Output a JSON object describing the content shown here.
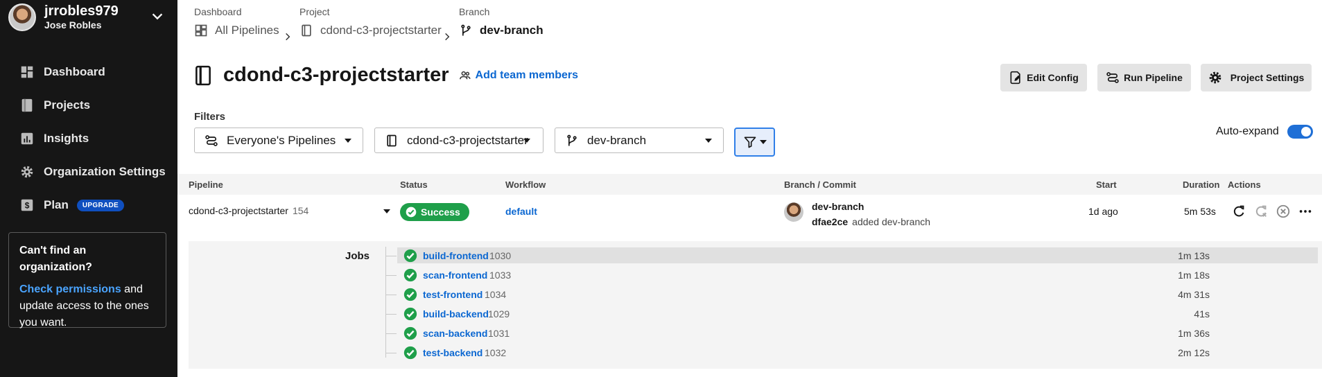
{
  "user": {
    "username": "jrrobles979",
    "full_name": "Jose Robles"
  },
  "nav": [
    {
      "label": "Dashboard",
      "icon": "dashboard-icon"
    },
    {
      "label": "Projects",
      "icon": "projects-icon"
    },
    {
      "label": "Insights",
      "icon": "insights-icon"
    },
    {
      "label": "Organization Settings",
      "icon": "gear-icon"
    },
    {
      "label": "Plan",
      "icon": "plan-icon",
      "badge": "UPGRADE"
    }
  ],
  "org_card": {
    "title": "Can't find an organization?",
    "link": "Check permissions",
    "text": " and update access to the ones you want."
  },
  "breadcrumb": {
    "dashboard_label": "Dashboard",
    "dashboard_value": "All Pipelines",
    "project_label": "Project",
    "project_value": "cdond-c3-projectstarter",
    "branch_label": "Branch",
    "branch_value": "dev-branch"
  },
  "header": {
    "title": "cdond-c3-projectstarter",
    "add_team": "Add team members",
    "edit_config": "Edit Config",
    "run_pipeline": "Run Pipeline",
    "project_settings": "Project Settings"
  },
  "filters": {
    "label": "Filters",
    "pipelines": "Everyone's Pipelines",
    "project": "cdond-c3-projectstarter",
    "branch": "dev-branch",
    "auto_expand": "Auto-expand",
    "auto_expand_on": true
  },
  "table": {
    "headers": [
      "Pipeline",
      "Status",
      "Workflow",
      "Branch / Commit",
      "Start",
      "Duration",
      "Actions"
    ],
    "pipeline": {
      "name": "cdond-c3-projectstarter",
      "number": "154",
      "status": "Success",
      "workflow": "default",
      "branch": "dev-branch",
      "commit_hash": "dfae2ce",
      "commit_msg": "added dev-branch",
      "start": "1d ago",
      "duration": "5m 53s"
    },
    "jobs_label": "Jobs",
    "jobs": [
      {
        "name": "build-frontend",
        "number": "1030",
        "duration": "1m 13s"
      },
      {
        "name": "scan-frontend",
        "number": "1033",
        "duration": "1m 18s"
      },
      {
        "name": "test-frontend",
        "number": "1034",
        "duration": "4m 31s"
      },
      {
        "name": "build-backend",
        "number": "1029",
        "duration": "41s"
      },
      {
        "name": "scan-backend",
        "number": "1031",
        "duration": "1m 36s"
      },
      {
        "name": "test-backend",
        "number": "1032",
        "duration": "2m 12s"
      }
    ]
  },
  "colors": {
    "success": "#1f9f4a",
    "link": "#0b67d1",
    "sidebar": "#161616"
  }
}
